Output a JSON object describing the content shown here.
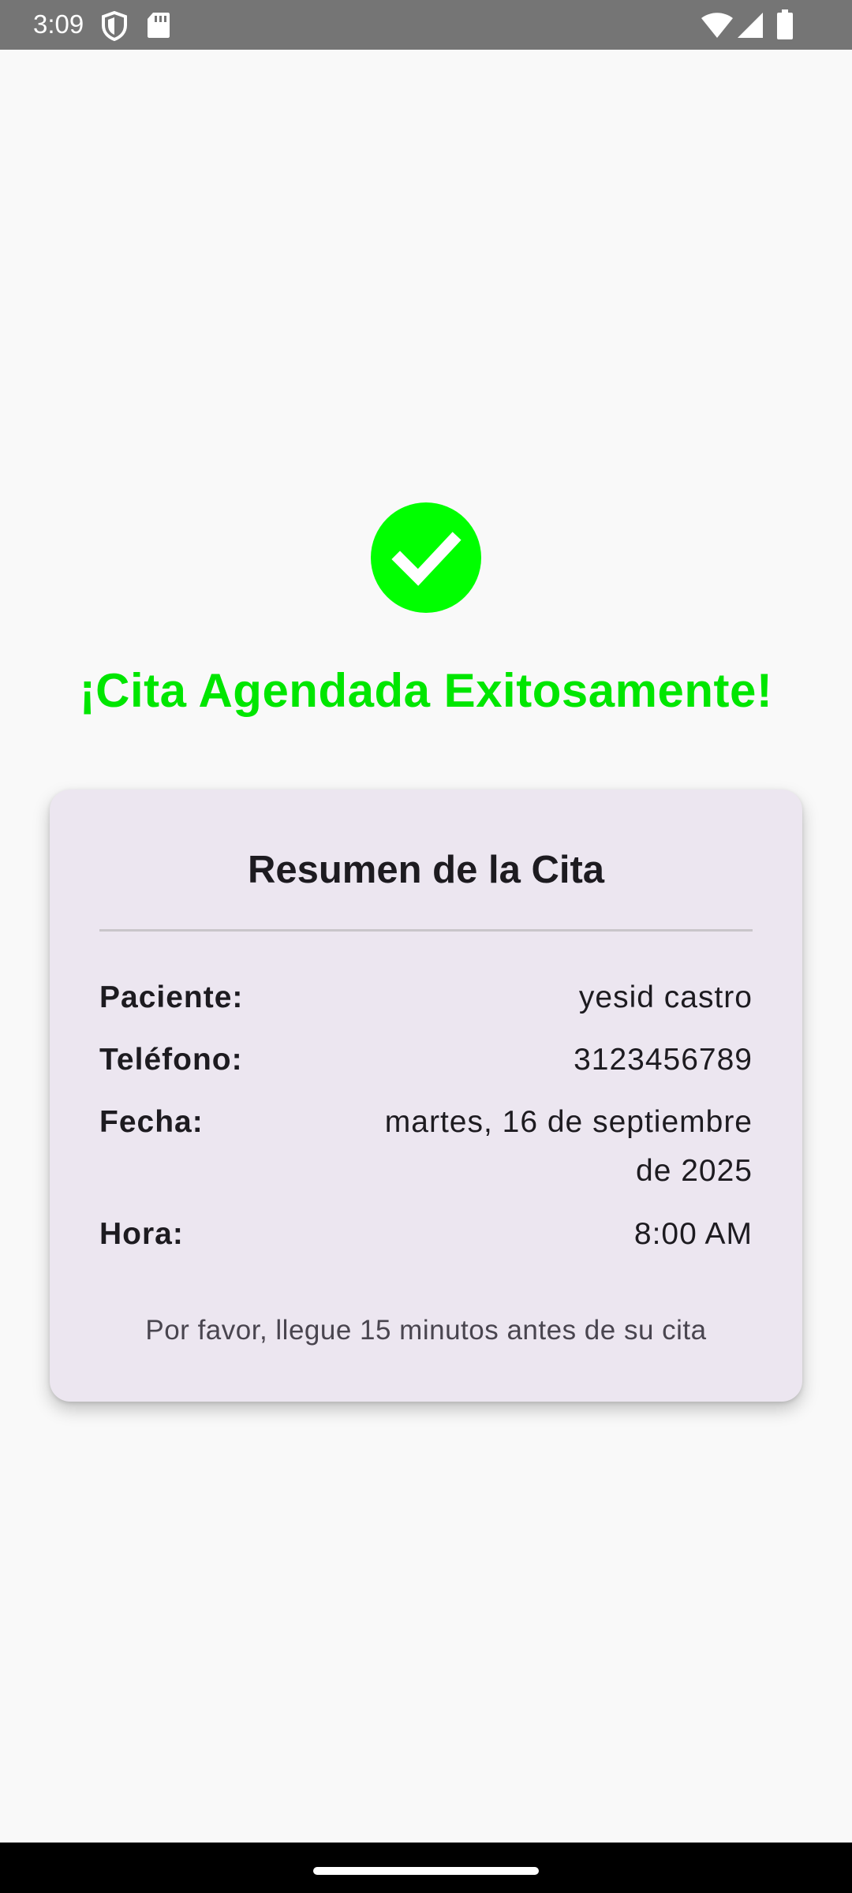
{
  "status_bar": {
    "time": "3:09",
    "icons": [
      "shield-icon",
      "sd-card-icon",
      "wifi-icon",
      "cellular-signal-icon",
      "battery-icon"
    ]
  },
  "success": {
    "icon": "check-circle-icon",
    "accent_color": "#00e600",
    "title": "¡Cita Agendada Exitosamente!"
  },
  "summary_card": {
    "title": "Resumen de la Cita",
    "rows": [
      {
        "label": "Paciente:",
        "value": "yesid castro"
      },
      {
        "label": "Teléfono:",
        "value": "3123456789"
      },
      {
        "label": "Fecha:",
        "value": "martes, 16 de septiembre de 2025"
      },
      {
        "label": "Hora:",
        "value": "8:00 AM"
      }
    ],
    "note": "Por favor, llegue 15 minutos antes de su cita"
  }
}
